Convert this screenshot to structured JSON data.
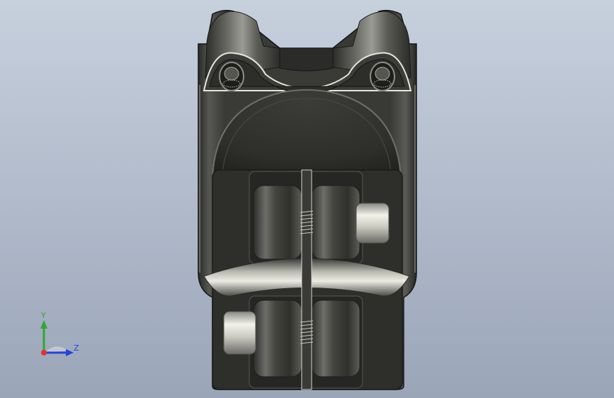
{
  "viewport": {
    "background_top": "#c5cfdc",
    "background_bottom": "#9aa6b9"
  },
  "model": {
    "body_color": "#2f302c",
    "highlight_color": "#f2f2ea",
    "icon": "bike-stem-clamp-model"
  },
  "triad": {
    "x_axis_color": "#e53030",
    "y_axis_color": "#2fa82f",
    "z_axis_color": "#1f45e0",
    "y_label": "Y",
    "z_label": "Z"
  }
}
